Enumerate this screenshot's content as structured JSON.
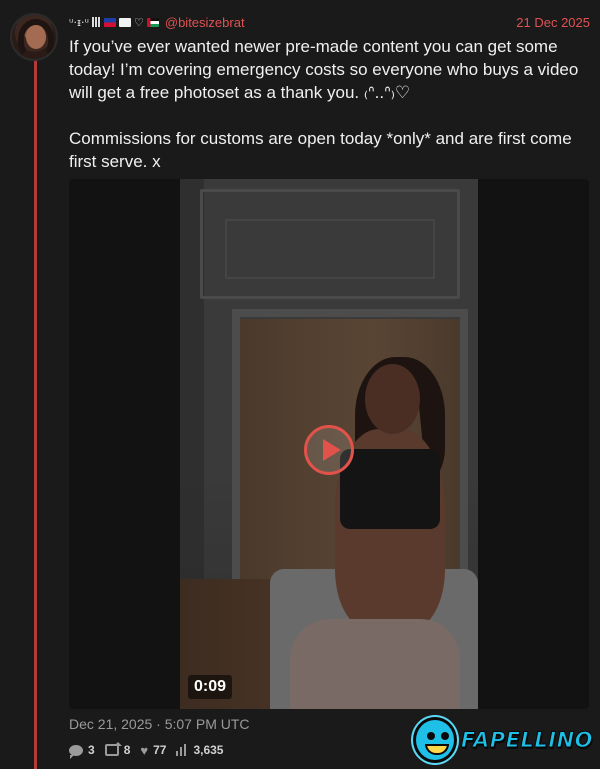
{
  "post": {
    "display_name": "ᵘ·ᵻ·ᵘ",
    "handle": "@bitesizebrat",
    "date": "21 Dec 2025",
    "text": "If you’ve ever wanted newer pre-made content you can get some today! I’m covering emergency costs so everyone who buys a video will get a free photoset as a thank you. ₍ᐢ..ᐢ₎♡\n\nCommissions for customs are open today *only* and are first come first serve. x",
    "timestamp": "Dec 21, 2025 · 5:07 PM UTC"
  },
  "media": {
    "duration": "0:09"
  },
  "stats": {
    "comments": "3",
    "reposts": "8",
    "likes": "77",
    "views": "3,635"
  },
  "watermark": {
    "text": "FAPELLINO"
  },
  "colors": {
    "background": "#1a1a1a",
    "accent": "#e05252",
    "thread_line": "#b23a3a",
    "watermark": "#1ec0e8"
  }
}
